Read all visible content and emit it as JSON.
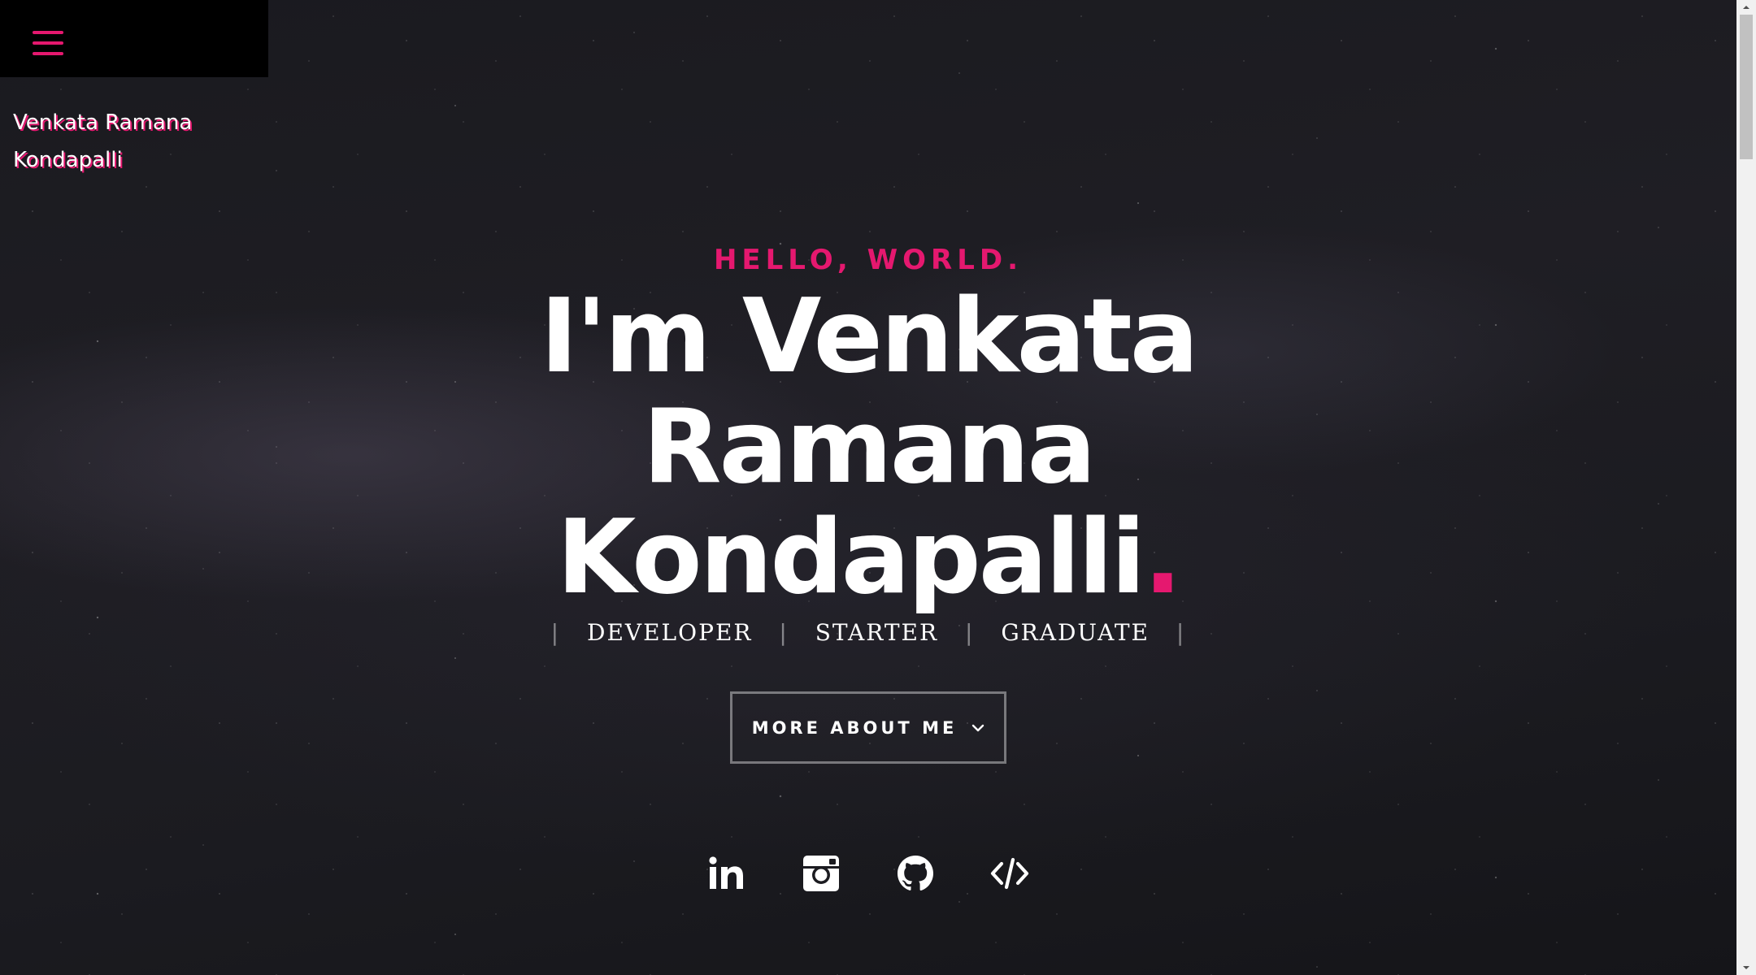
{
  "brand": {
    "line1": "Venkata Ramana",
    "line2": "Kondapalli"
  },
  "menu": {
    "icon": "hamburger-menu-icon"
  },
  "hero": {
    "greeting": "HELLO, WORLD.",
    "headline_line1": "I'm Venkata Ramana",
    "headline_line2": "Kondapalli",
    "headline_period": ".",
    "roles": [
      "DEVELOPER",
      "STARTER",
      "GRADUATE"
    ],
    "separator": "|",
    "cta_label": "MORE ABOUT ME",
    "cta_icon": "chevron-down-icon"
  },
  "social": [
    {
      "name": "linkedin-icon"
    },
    {
      "name": "instagram-icon"
    },
    {
      "name": "github-icon"
    },
    {
      "name": "code-icon"
    }
  ],
  "colors": {
    "accent": "#e5186f",
    "text": "#ffffff",
    "background": "#1b1b20"
  }
}
